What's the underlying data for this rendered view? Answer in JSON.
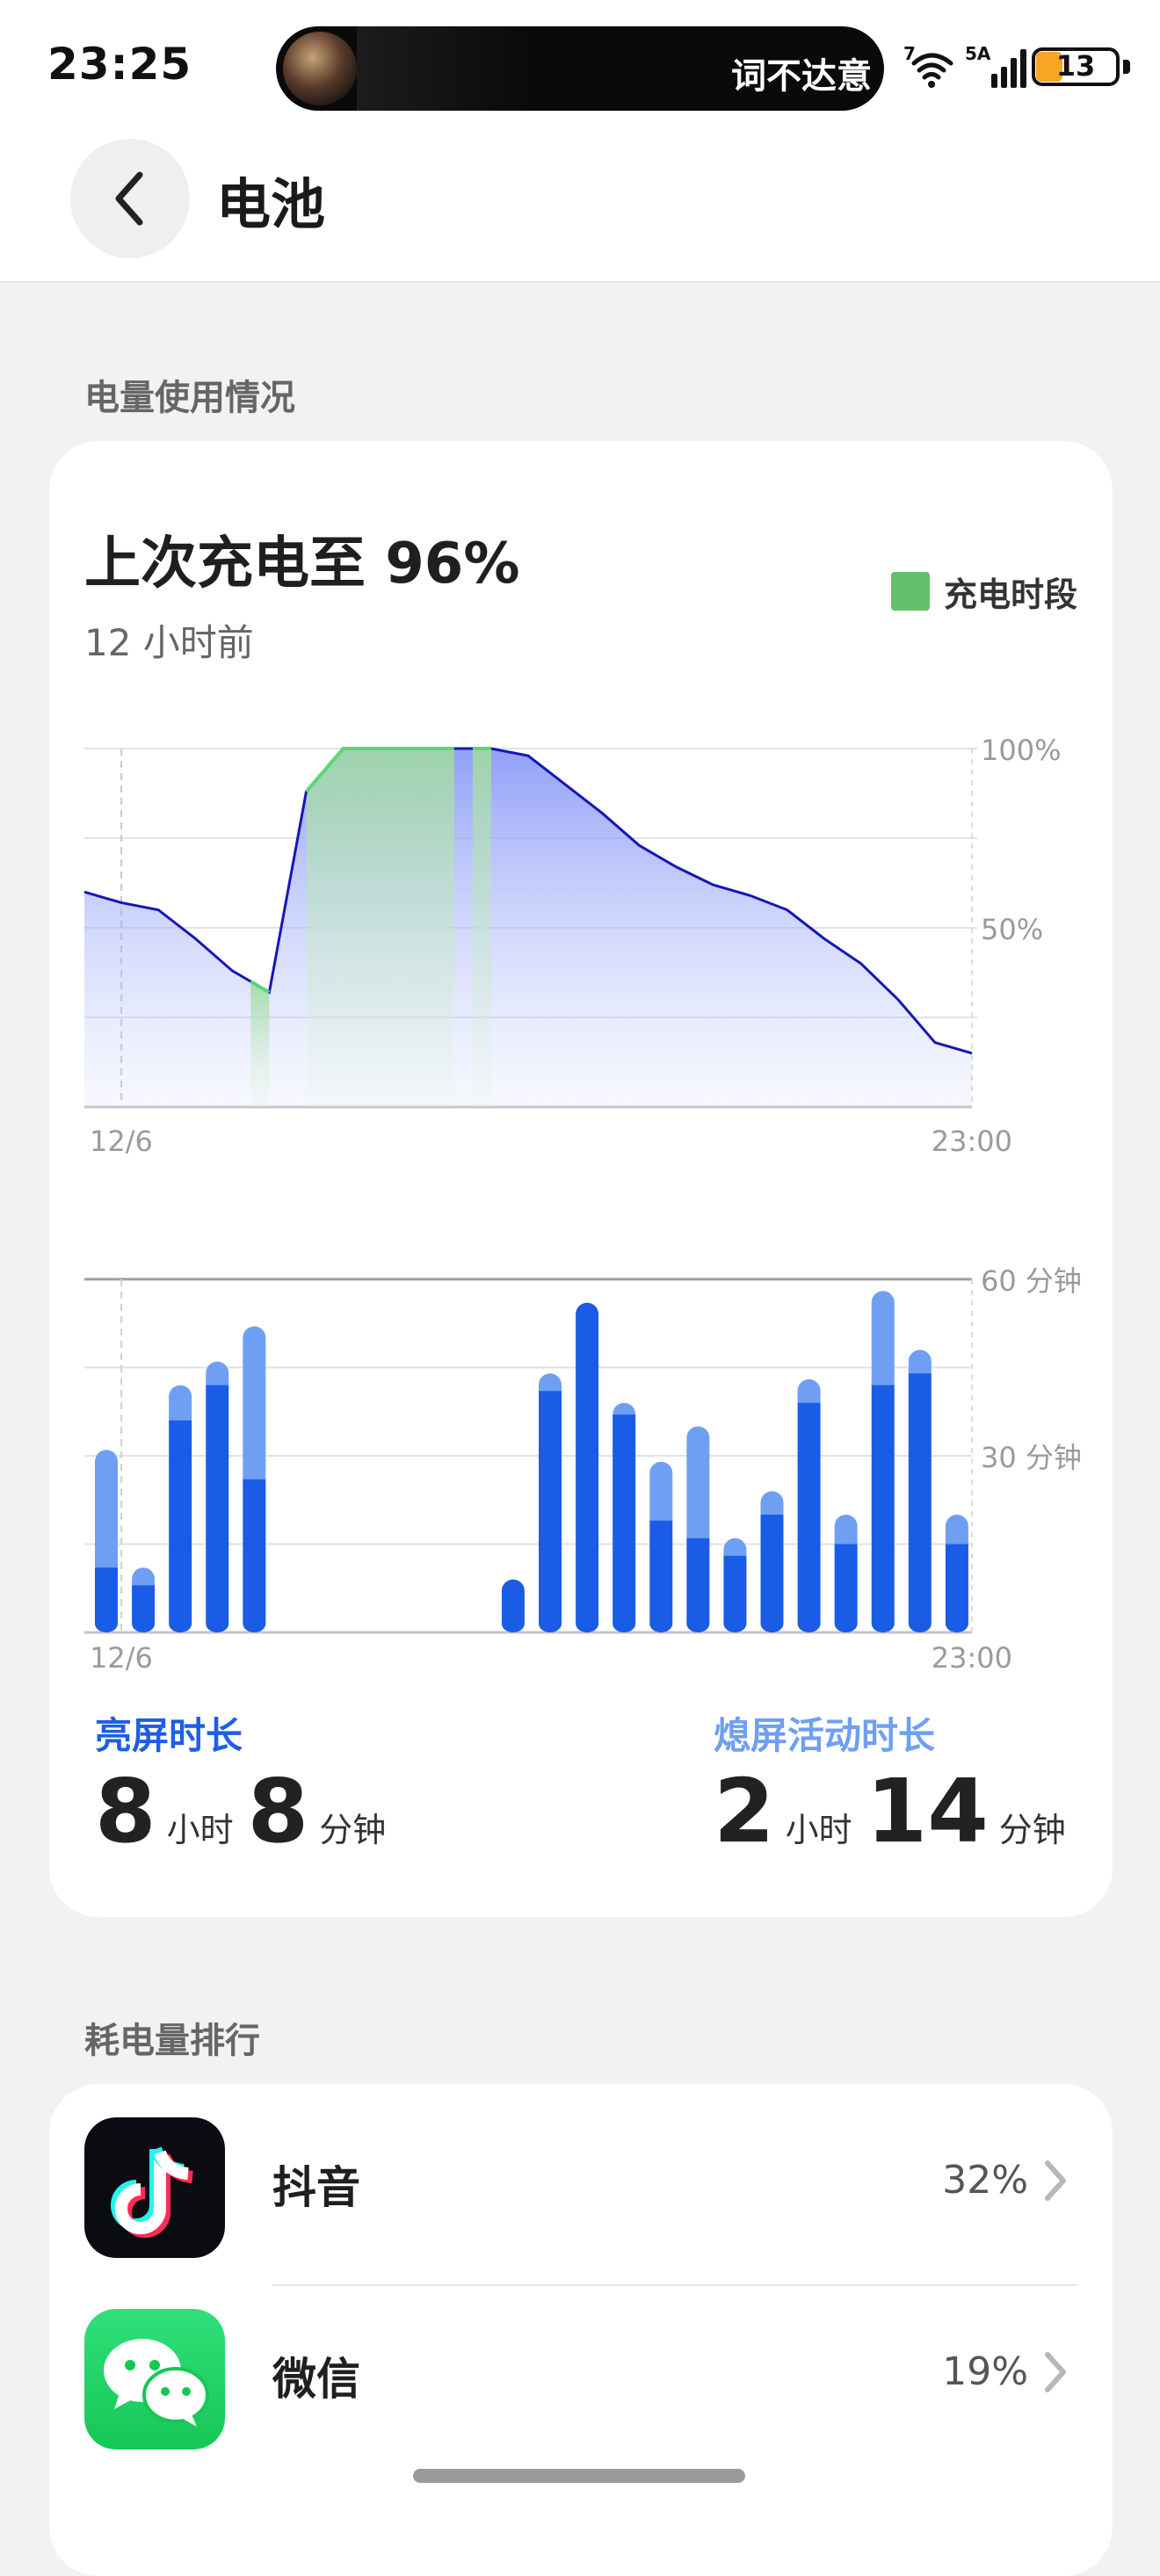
{
  "status_bar": {
    "time": "23:25",
    "now_playing": "词不达意",
    "network_badge_wifi": "7",
    "network_badge_cell": "5A",
    "battery_level": "13",
    "icons": [
      "wifi-icon",
      "cell-signal-icon",
      "battery-icon"
    ]
  },
  "header": {
    "title": "电池",
    "back_icon": "chevron-left-icon"
  },
  "usage": {
    "section_title": "电量使用情况",
    "last_charge": "上次充电至 96%",
    "last_charge_ago": "12 小时前",
    "legend_label": "充电时段",
    "screen_on_label": "亮屏时长",
    "screen_on_hours": "8",
    "screen_on_minutes": "8",
    "screen_off_label": "熄屏活动时长",
    "screen_off_hours": "2",
    "screen_off_minutes": "14",
    "unit_hour": "小时",
    "unit_minute": "分钟"
  },
  "colors": {
    "charging": "#64c06a",
    "line": "#1616b8",
    "screen_on": "#1a5ce6",
    "screen_off": "#6e9ff3",
    "label_on": "#1d5fe4",
    "label_off": "#6e9ff3"
  },
  "chart_data": [
    {
      "type": "area",
      "ylabel": "",
      "y_tick_labels": [
        "100%",
        "50%"
      ],
      "x_tick_labels": [
        "12/6",
        "23:00"
      ],
      "ylim": [
        0,
        100
      ],
      "x_hours": [
        0,
        1,
        2,
        3,
        4,
        5,
        6,
        7,
        8,
        9,
        10,
        11,
        12,
        13,
        14,
        15,
        16,
        17,
        18,
        19,
        20,
        21,
        22,
        23,
        24
      ],
      "series": [
        {
          "values": [
            60,
            57,
            55,
            47,
            38,
            32,
            88,
            100,
            100,
            100,
            100,
            100,
            98,
            90,
            82,
            73,
            67,
            62,
            59,
            55,
            47,
            40,
            30,
            18,
            15
          ]
        }
      ],
      "charging_periods": [
        [
          4.5,
          5
        ],
        [
          6,
          10
        ],
        [
          10.5,
          11
        ]
      ]
    },
    {
      "type": "bar",
      "ylabel": "",
      "y_tick_labels": [
        "60 分钟",
        "30 分钟"
      ],
      "x_tick_labels": [
        "12/6",
        "23:00"
      ],
      "ylim": [
        0,
        60
      ],
      "categories": [
        0,
        1,
        2,
        3,
        4,
        5,
        6,
        7,
        8,
        9,
        10,
        11,
        12,
        13,
        14,
        15,
        16,
        17,
        18,
        19,
        20,
        21,
        22,
        23
      ],
      "series": [
        {
          "key": "screen_on",
          "values": [
            11,
            8,
            36,
            42,
            26,
            0,
            0,
            0,
            0,
            0,
            0,
            9,
            41,
            56,
            37,
            19,
            16,
            13,
            20,
            39,
            15,
            42,
            44,
            15
          ]
        },
        {
          "key": "screen_off",
          "values": [
            20,
            3,
            6,
            4,
            26,
            0,
            0,
            0,
            0,
            0,
            0,
            0,
            3,
            0,
            2,
            10,
            19,
            3,
            4,
            4,
            5,
            16,
            4,
            5
          ]
        }
      ]
    }
  ],
  "ranking": {
    "section_title": "耗电量排行",
    "apps": [
      {
        "name": "抖音",
        "percent": "32%",
        "icon": "douyin-icon"
      },
      {
        "name": "微信",
        "percent": "19%",
        "icon": "wechat-icon"
      }
    ]
  }
}
